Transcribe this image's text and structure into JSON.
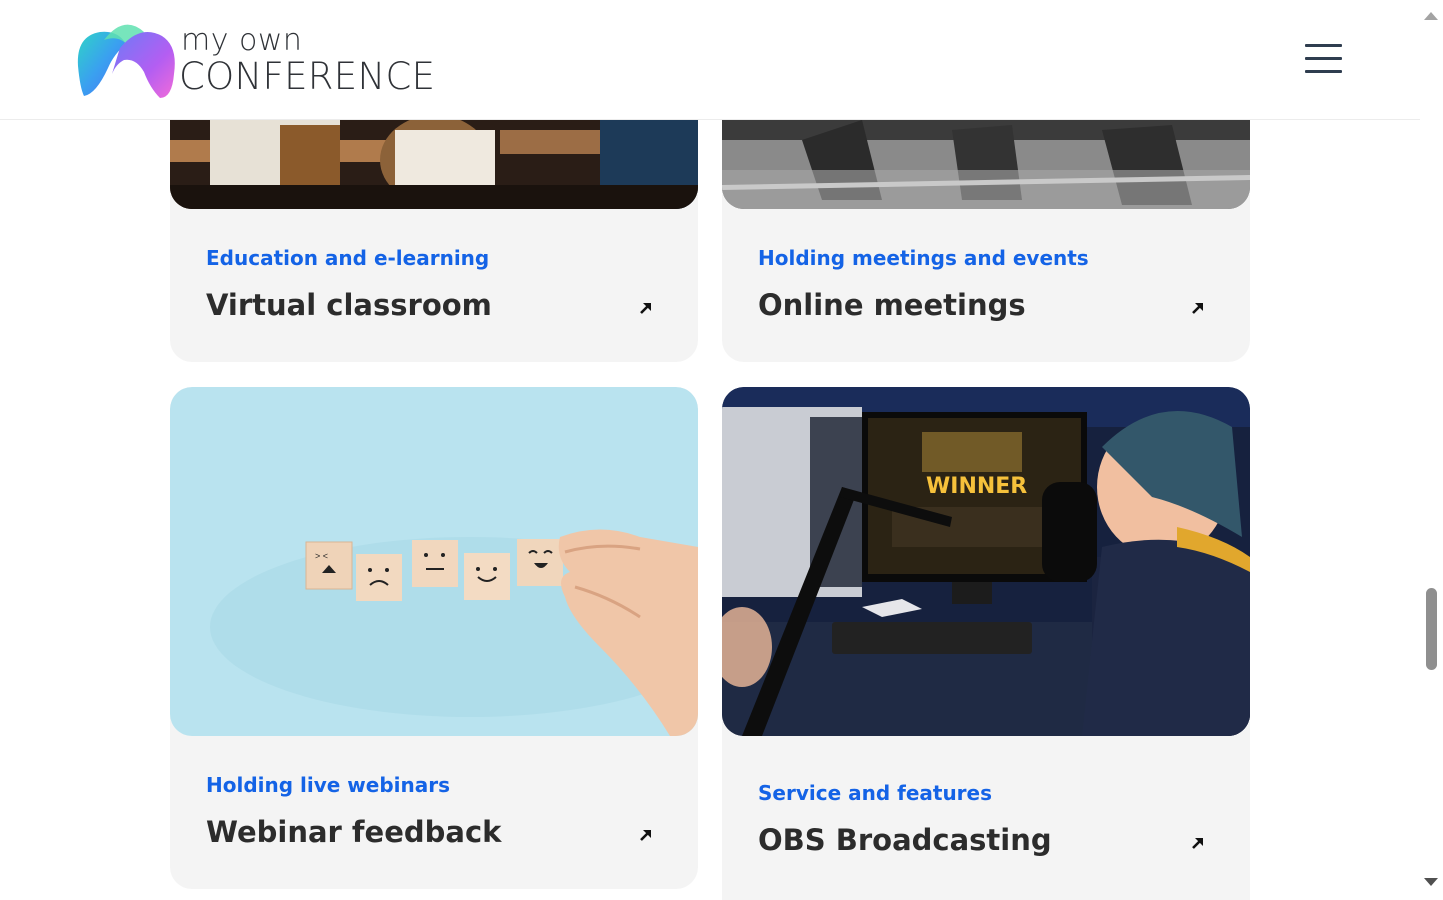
{
  "header": {
    "logo_line1": "my own",
    "logo_line2": "CONFERENCE",
    "menu_icon": "hamburger-menu-icon"
  },
  "cards": [
    {
      "category": "Education and e-learning",
      "title": "Virtual classroom",
      "arrow_icon": "arrow-up-right-icon"
    },
    {
      "category": "Holding meetings and events",
      "title": "Online meetings",
      "arrow_icon": "arrow-up-right-icon"
    },
    {
      "category": "Holding live webinars",
      "title": "Webinar feedback",
      "arrow_icon": "arrow-up-right-icon"
    },
    {
      "category": "Service and features",
      "title": "OBS Broadcasting",
      "arrow_icon": "arrow-up-right-icon"
    }
  ],
  "colors": {
    "category": "#1463e6",
    "title": "#2c2c2c",
    "card_background": "#f4f4f4"
  }
}
